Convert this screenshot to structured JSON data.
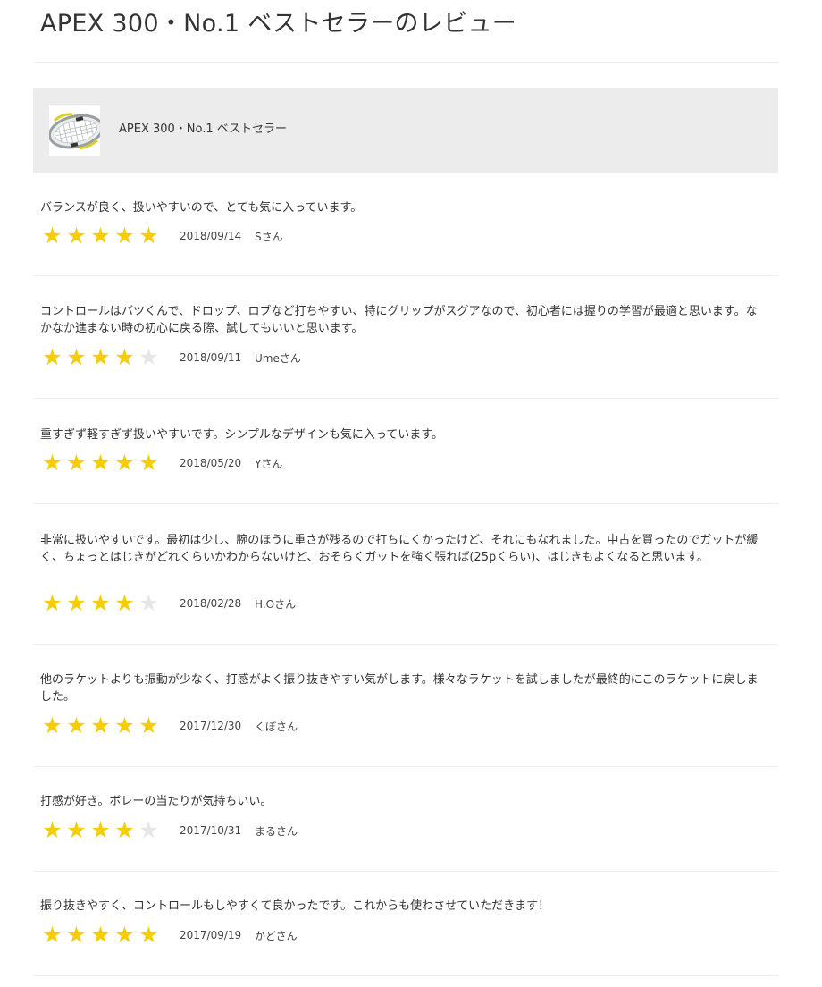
{
  "page": {
    "title": "APEX 300・No.1 ベストセラーのレビュー"
  },
  "product": {
    "name": "APEX 300・No.1 ベストセラー",
    "thumbnail_icon": "tennis-racket-icon"
  },
  "colors": {
    "star_on": "#f5cd00",
    "star_off": "#e6e6e6",
    "product_box_bg": "#ececec",
    "divider": "#eeeeee"
  },
  "reviews": [
    {
      "text": "バランスが良く、扱いやすいので、とても気に入っています。",
      "rating": 5,
      "max_rating": 5,
      "date": "2018/09/14",
      "author": "Sさん"
    },
    {
      "text": "コントロールはバツくんで、ドロップ、ロブなど打ちやすい、特にグリップがスグアなので、初心者には握りの学習が最適と思います。なかなか進まない時の初心に戻る際、試してもいいと思います。",
      "rating": 4,
      "max_rating": 5,
      "date": "2018/09/11",
      "author": "Umeさん"
    },
    {
      "text": "重すぎず軽すぎず扱いやすいです。シンプルなデザインも気に入っています。",
      "rating": 5,
      "max_rating": 5,
      "date": "2018/05/20",
      "author": "Yさん"
    },
    {
      "text": "非常に扱いやすいです。最初は少し、腕のほうに重さが残るので打ちにくかったけど、それにもなれました。中古を買ったのでガットが緩く、ちょっとはじきがどれくらいかわからないけど、おそらくガットを強く張れば(25pくらい)、はじきもよくなると思います。",
      "rating": 4,
      "max_rating": 5,
      "date": "2018/02/28",
      "author": "H.Oさん"
    },
    {
      "text": "他のラケットよりも振動が少なく、打感がよく振り抜きやすい気がします。様々なラケットを試しましたが最終的にこのラケットに戻しました。",
      "rating": 5,
      "max_rating": 5,
      "date": "2017/12/30",
      "author": "くぼさん"
    },
    {
      "text": "打感が好き。ボレーの当たりが気持ちいい。",
      "rating": 4,
      "max_rating": 5,
      "date": "2017/10/31",
      "author": "まるさん"
    },
    {
      "text": "振り抜きやすく、コントロールもしやすくて良かったです。これからも使わさせていただきます！",
      "rating": 5,
      "max_rating": 5,
      "date": "2017/09/19",
      "author": "かどさん"
    }
  ]
}
